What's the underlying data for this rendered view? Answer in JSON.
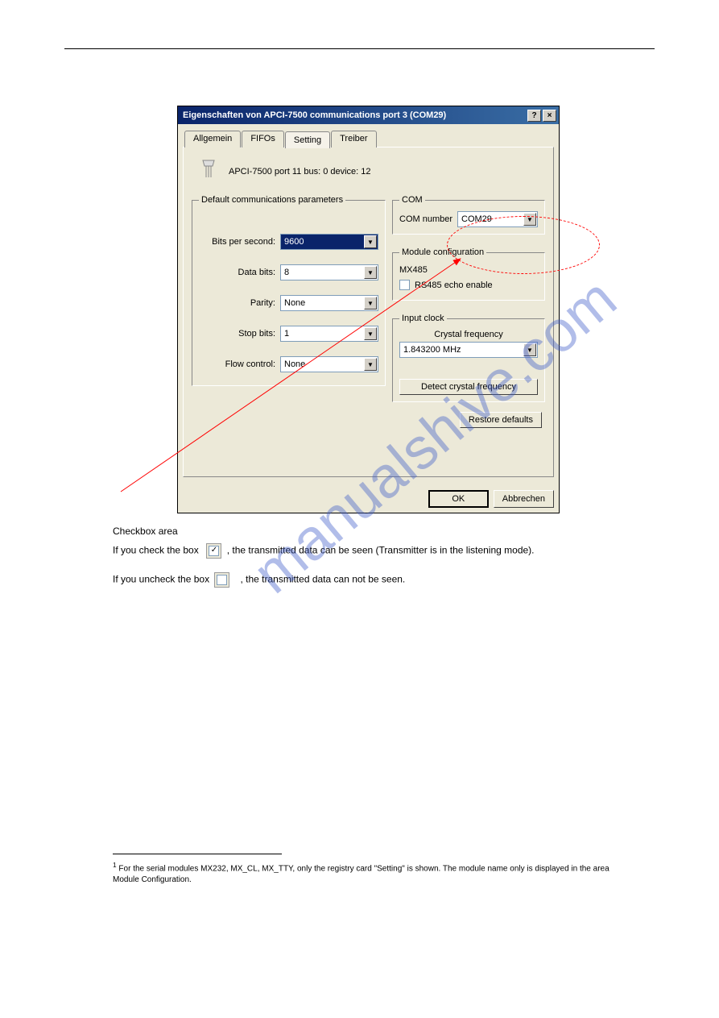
{
  "watermark": "manualshive.com",
  "dialog": {
    "title": "Eigenschaften von APCI-7500 communications port 3 (COM29)",
    "help_btn": "?",
    "close_btn": "×",
    "tabs": {
      "allgemein": "Allgemein",
      "fifos": "FIFOs",
      "setting": "Setting",
      "treiber": "Treiber"
    },
    "device_line": "APCI-7500 port 11 bus: 0 device: 12",
    "defaults_group": "Default communications parameters",
    "fields": {
      "bps_label": "Bits per second:",
      "bps_value": "9600",
      "data_bits_label": "Data bits:",
      "data_bits_value": "8",
      "parity_label": "Parity:",
      "parity_value": "None",
      "stop_bits_label": "Stop bits:",
      "stop_bits_value": "1",
      "flow_label": "Flow control:",
      "flow_value": "None"
    },
    "com_group": "COM",
    "com_number_label": "COM number",
    "com_number_value": "COM29",
    "mod_group": "Module configuration",
    "mod_name": "MX485",
    "rs485_label": "RS485 echo enable",
    "clock_group": "Input clock",
    "crystal_label": "Crystal frequency",
    "crystal_value": "1.843200 MHz",
    "detect_btn": "Detect crystal frequency",
    "restore_btn": "Restore defaults",
    "ok_btn": "OK",
    "cancel_btn": "Abbrechen"
  },
  "text": {
    "cb_area_label": "Checkbox area",
    "para1_a": "If you check the box ",
    "para1_b": ", the transmitted data can be seen (Transmitter is in the ",
    "para1_c": "listening mode).",
    "para2_a": "If you uncheck the box",
    "para2_b": " ",
    "para2_c": ", the transmitted data can not be seen.",
    "footnote_num": "1",
    "footnote_text": " For the serial modules MX232, MX_CL, MX_TTY, only the registry card \"Setting\" is shown. The module name only is displayed in the area Module Configuration."
  }
}
